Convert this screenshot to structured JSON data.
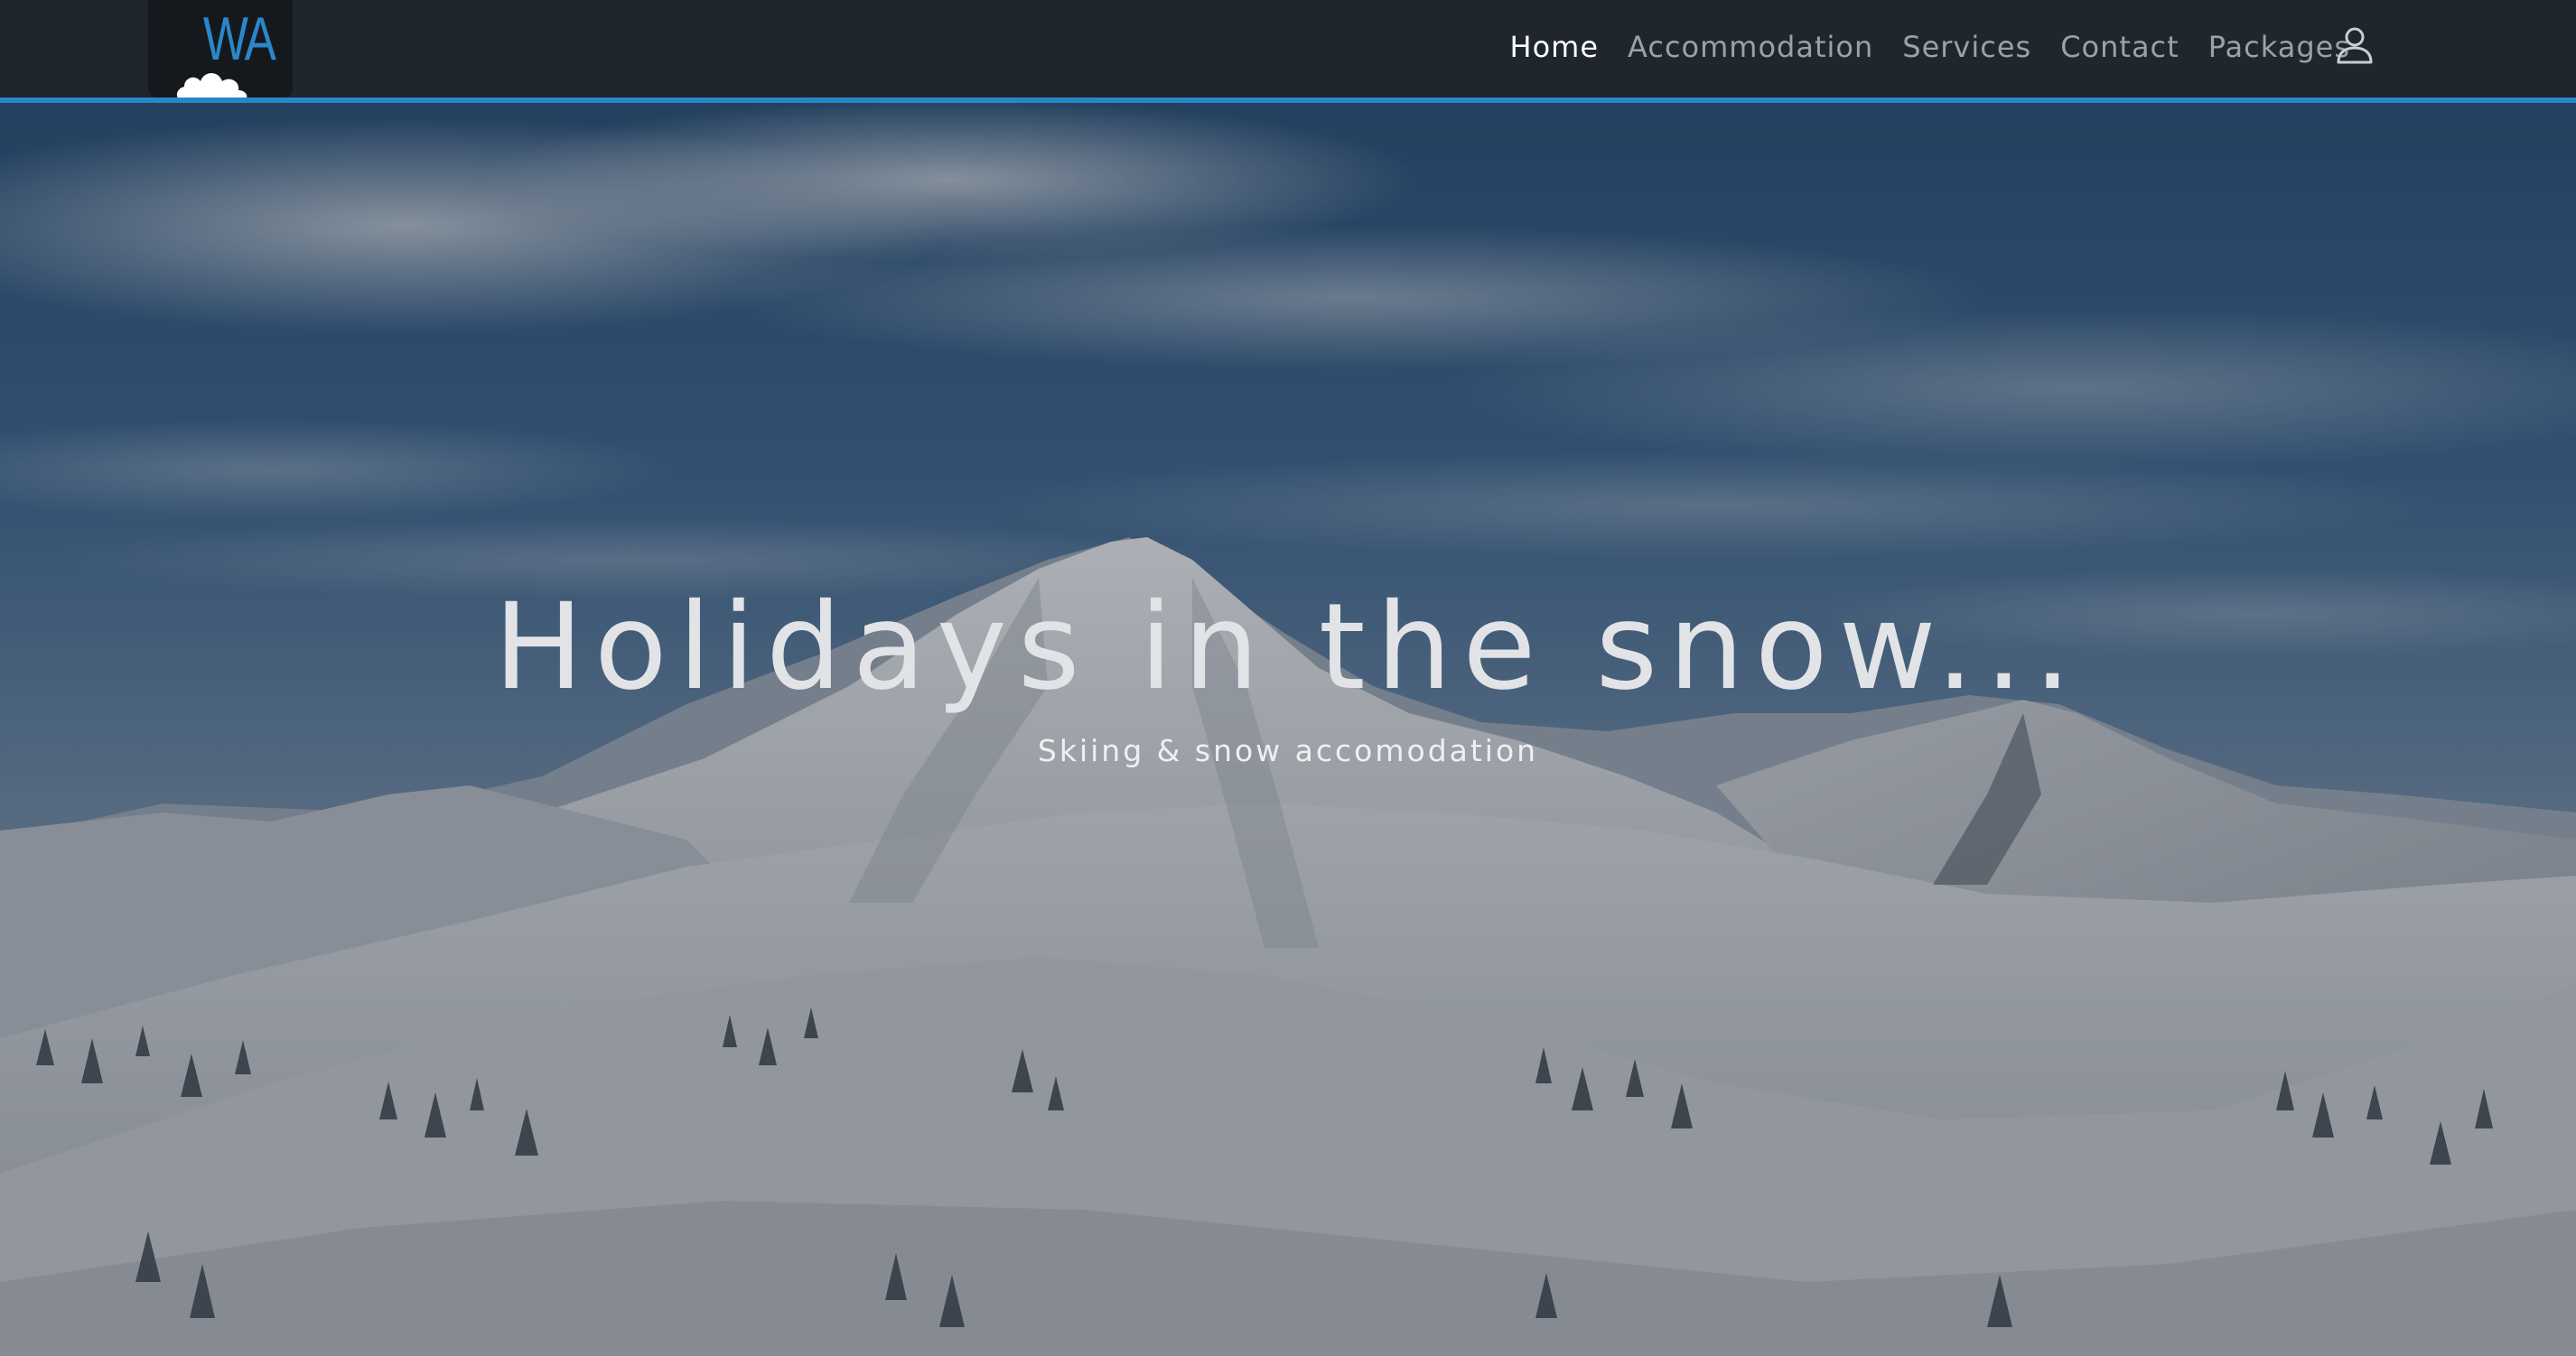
{
  "brand": {
    "logo_text": "WA",
    "logo_color": "#2b86c8"
  },
  "nav": {
    "items": [
      {
        "label": "Home",
        "active": true
      },
      {
        "label": "Accommodation",
        "active": false
      },
      {
        "label": "Services",
        "active": false
      },
      {
        "label": "Contact",
        "active": false
      },
      {
        "label": "Packages",
        "active": false
      }
    ],
    "user_icon": "user-icon",
    "accent_color": "#2b86c8"
  },
  "hero": {
    "title": "Holidays in the snow...",
    "subtitle": "Skiing & snow accomodation",
    "background": "snowy-mountain-landscape"
  }
}
